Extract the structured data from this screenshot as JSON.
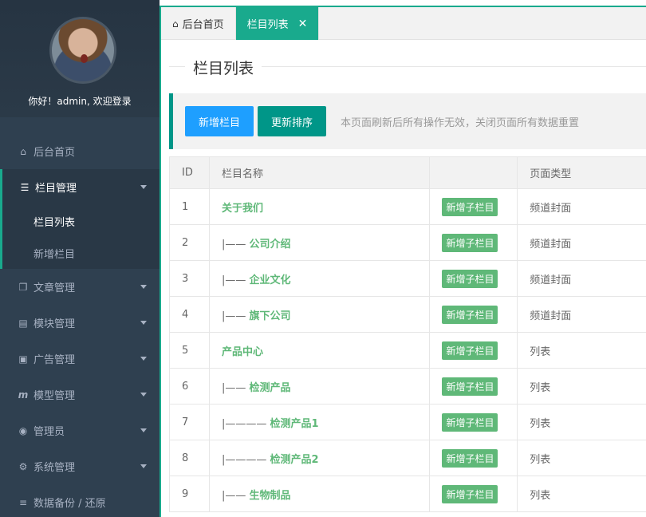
{
  "sidebar": {
    "greeting": "你好！admin, 欢迎登录",
    "menu": [
      {
        "icon": "home-icon",
        "glyph": "⌂",
        "label": "后台首页"
      },
      {
        "icon": "list-icon",
        "glyph": "☰",
        "label": "栏目管理"
      },
      {
        "icon": "copy-icon",
        "glyph": "❐",
        "label": "文章管理"
      },
      {
        "icon": "module-icon",
        "glyph": "▤",
        "label": "模块管理"
      },
      {
        "icon": "image-icon",
        "glyph": "▣",
        "label": "广告管理"
      },
      {
        "icon": "model-icon",
        "glyph": "m",
        "label": "模型管理"
      },
      {
        "icon": "user-icon",
        "glyph": "◉",
        "label": "管理员"
      },
      {
        "icon": "cogs-icon",
        "glyph": "⚙",
        "label": "系统管理"
      },
      {
        "icon": "database-icon",
        "glyph": "≡",
        "label": "数据备份 / 还原"
      }
    ],
    "submenu": [
      {
        "label": "栏目列表"
      },
      {
        "label": "新增栏目"
      }
    ]
  },
  "tabs": [
    {
      "icon": "home-icon",
      "label": "后台首页"
    },
    {
      "label": "栏目列表",
      "close": "✕"
    }
  ],
  "page": {
    "title": "栏目列表",
    "add_button": "新增栏目",
    "sort_button": "更新排序",
    "tip": "本页面刷新后所有操作无效，关闭页面所有数据重置"
  },
  "table": {
    "headers": [
      "ID",
      "栏目名称",
      "",
      "页面类型"
    ],
    "rows": [
      {
        "id": "1",
        "prefix": "",
        "name": "关于我们",
        "action": "新增子栏目",
        "type": "频道封面"
      },
      {
        "id": "2",
        "prefix": "|—— ",
        "name": "公司介绍",
        "action": "新增子栏目",
        "type": "频道封面"
      },
      {
        "id": "3",
        "prefix": "|—— ",
        "name": "企业文化",
        "action": "新增子栏目",
        "type": "频道封面"
      },
      {
        "id": "4",
        "prefix": "|—— ",
        "name": "旗下公司",
        "action": "新增子栏目",
        "type": "频道封面"
      },
      {
        "id": "5",
        "prefix": "",
        "name": "产品中心",
        "action": "新增子栏目",
        "type": "列表"
      },
      {
        "id": "6",
        "prefix": "|—— ",
        "name": "检测产品",
        "action": "新增子栏目",
        "type": "列表"
      },
      {
        "id": "7",
        "prefix": "|———— ",
        "name": "检测产品1",
        "action": "新增子栏目",
        "type": "列表"
      },
      {
        "id": "8",
        "prefix": "|———— ",
        "name": "检测产品2",
        "action": "新增子栏目",
        "type": "列表"
      },
      {
        "id": "9",
        "prefix": "|—— ",
        "name": "生物制品",
        "action": "新增子栏目",
        "type": "列表"
      }
    ]
  },
  "colors": {
    "accent": "#19aa8d",
    "primary": "#009688",
    "blue": "#1e9fff",
    "badge": "#5fb878",
    "sidebar": "#2f4050"
  }
}
